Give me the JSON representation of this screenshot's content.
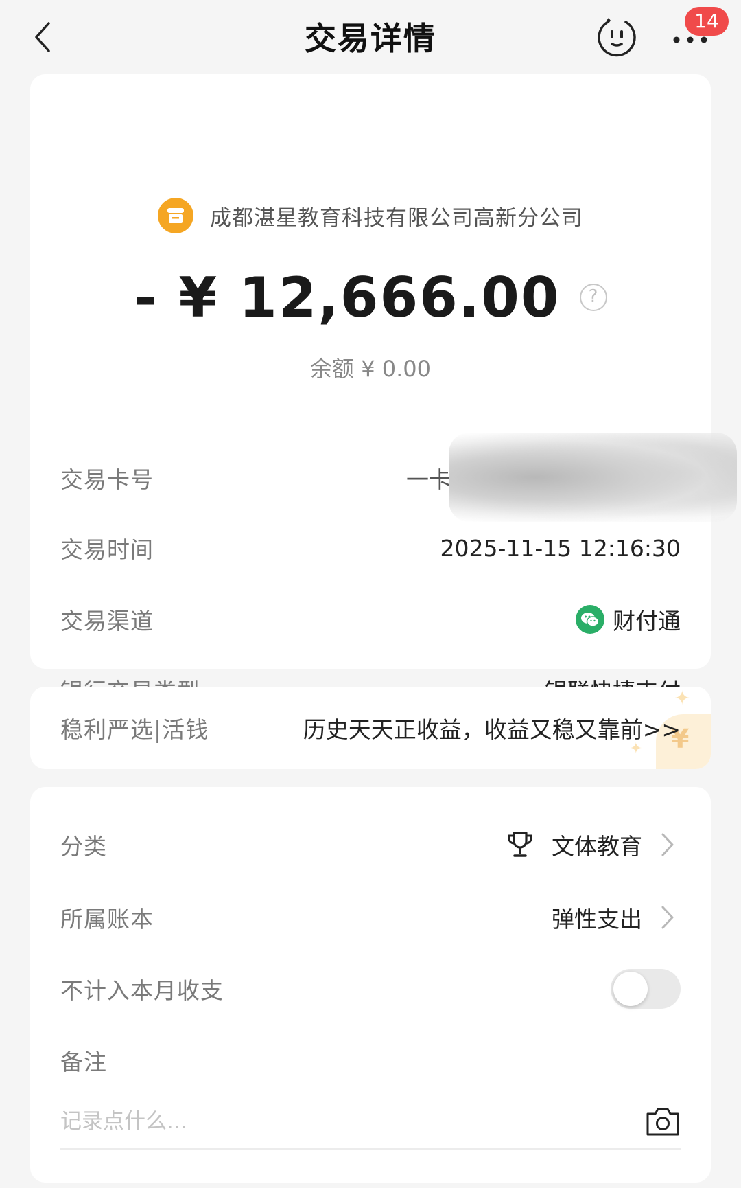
{
  "header": {
    "title": "交易详情",
    "notification_count": "14",
    "icons": [
      "back-icon",
      "service-bot-icon",
      "more-icon"
    ]
  },
  "transaction": {
    "merchant": "成都湛星教育科技有限公司高新分公司",
    "amount": "- ¥ 12,666.00",
    "balance": "余额 ¥ 0.00",
    "rows": {
      "card": {
        "label": "交易卡号",
        "value_prefix": "一卡"
      },
      "time": {
        "label": "交易时间",
        "value": "2025-11-15 12:16:30"
      },
      "channel": {
        "label": "交易渠道",
        "value": "财付通"
      },
      "type": {
        "label": "银行交易类型",
        "value": "银联快捷支付"
      }
    }
  },
  "promo": {
    "label": "稳利严选|活钱",
    "text": "历史天天正收益，收益又稳又靠前>>",
    "deco_symbol": "¥"
  },
  "settings": {
    "category": {
      "label": "分类",
      "value": "文体教育"
    },
    "book": {
      "label": "所属账本",
      "value": "弹性支出"
    },
    "exclude": {
      "label": "不计入本月收支",
      "toggle_on": false
    },
    "note": {
      "label": "备注",
      "placeholder": "记录点什么..."
    }
  },
  "colors": {
    "merchant_icon": "#f5a623",
    "badge": "#f04a4a",
    "wechat": "#2aae67"
  }
}
